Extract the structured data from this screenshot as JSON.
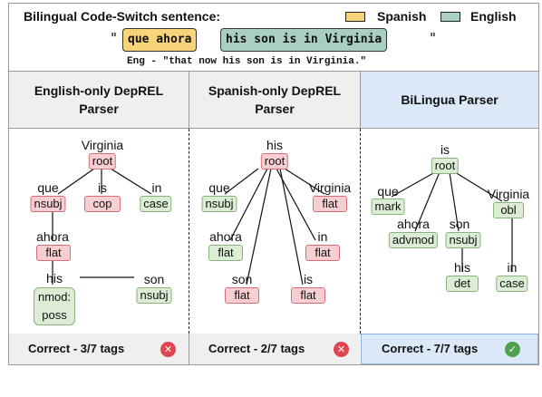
{
  "header": {
    "title": "Bilingual Code-Switch sentence:",
    "legend": [
      {
        "label": "Spanish",
        "color": "#f7d47a"
      },
      {
        "label": "English",
        "color": "#a9cfc2"
      }
    ],
    "open_quote": "\"",
    "close_quote": "\"",
    "spanish_span": "que ahora",
    "english_span": "his son is in Virginia",
    "translation": "Eng - \"that now his son is in Virginia.\""
  },
  "columns": [
    {
      "title": "English-only DepREL Parser",
      "result": "Correct - 3/7 tags",
      "status": "incorrect"
    },
    {
      "title": "Spanish-only DepREL Parser",
      "result": "Correct - 2/7 tags",
      "status": "incorrect"
    },
    {
      "title": "BiLingua Parser",
      "result": "Correct - 7/7 tags",
      "status": "correct"
    }
  ],
  "trees": [
    {
      "nodes": [
        {
          "word": "Virginia",
          "tag": "root",
          "correct": false
        },
        {
          "word": "que",
          "tag": "nsubj",
          "correct": false
        },
        {
          "word": "is",
          "tag": "cop",
          "correct": false
        },
        {
          "word": "in",
          "tag": "case",
          "correct": true
        },
        {
          "word": "ahora",
          "tag": "flat",
          "correct": false
        },
        {
          "word": "his",
          "tag": "nmod:\nposs",
          "correct": true
        },
        {
          "word": "son",
          "tag": "nsubj",
          "correct": true
        }
      ]
    },
    {
      "nodes": [
        {
          "word": "his",
          "tag": "root",
          "correct": false
        },
        {
          "word": "que",
          "tag": "nsubj",
          "correct": true
        },
        {
          "word": "Virginia",
          "tag": "flat",
          "correct": false
        },
        {
          "word": "ahora",
          "tag": "flat",
          "correct": true
        },
        {
          "word": "in",
          "tag": "flat",
          "correct": false
        },
        {
          "word": "son",
          "tag": "flat",
          "correct": false
        },
        {
          "word": "is",
          "tag": "flat",
          "correct": false
        }
      ]
    },
    {
      "nodes": [
        {
          "word": "is",
          "tag": "root",
          "correct": true
        },
        {
          "word": "que",
          "tag": "mark",
          "correct": true
        },
        {
          "word": "Virginia",
          "tag": "obl",
          "correct": true
        },
        {
          "word": "ahora",
          "tag": "advmod",
          "correct": true
        },
        {
          "word": "son",
          "tag": "nsubj",
          "correct": true
        },
        {
          "word": "his",
          "tag": "det",
          "correct": true
        },
        {
          "word": "in",
          "tag": "case",
          "correct": true
        }
      ]
    }
  ],
  "colors": {
    "correct_tag": "#dcecd5",
    "incorrect_tag": "#f7cfd2",
    "bilingua_header": "#dbe8f8"
  },
  "icons": {
    "incorrect": "x-circle-icon",
    "correct": "check-circle-icon"
  }
}
